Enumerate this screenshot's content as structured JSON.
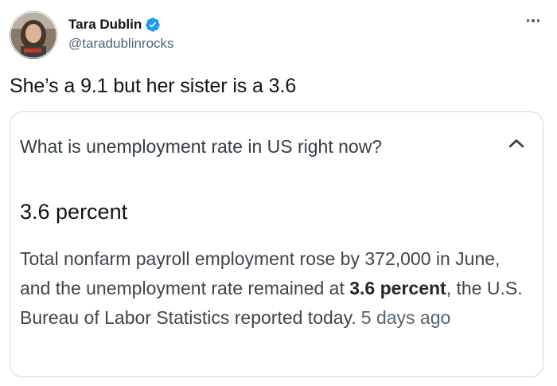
{
  "author": {
    "display_name": "Tara Dublin",
    "handle": "@taradublinrocks",
    "avatar_icon": "profile-photo",
    "verified_icon": "verified-badge-icon",
    "verified_color": "#1d9bf0"
  },
  "tweet": {
    "text": "She’s a 9.1 but her sister is a 3.6"
  },
  "card": {
    "question": "What is unemployment rate in US right now?",
    "answer": "3.6 percent",
    "snippet_part1": "Total nonfarm payroll employment rose by 372,000 in June, and the unemployment rate remained at ",
    "snippet_bold1": "3.6",
    "snippet_space": " ",
    "snippet_bold2": "percent",
    "snippet_part2": ", the U.S. Bureau of Labor Statistics reported today.",
    "date": "5 days ago",
    "toggle_icon": "chevron-up-icon"
  },
  "colors": {
    "text_primary": "#0f1419",
    "text_secondary": "#536471",
    "border": "#cfd9de"
  }
}
